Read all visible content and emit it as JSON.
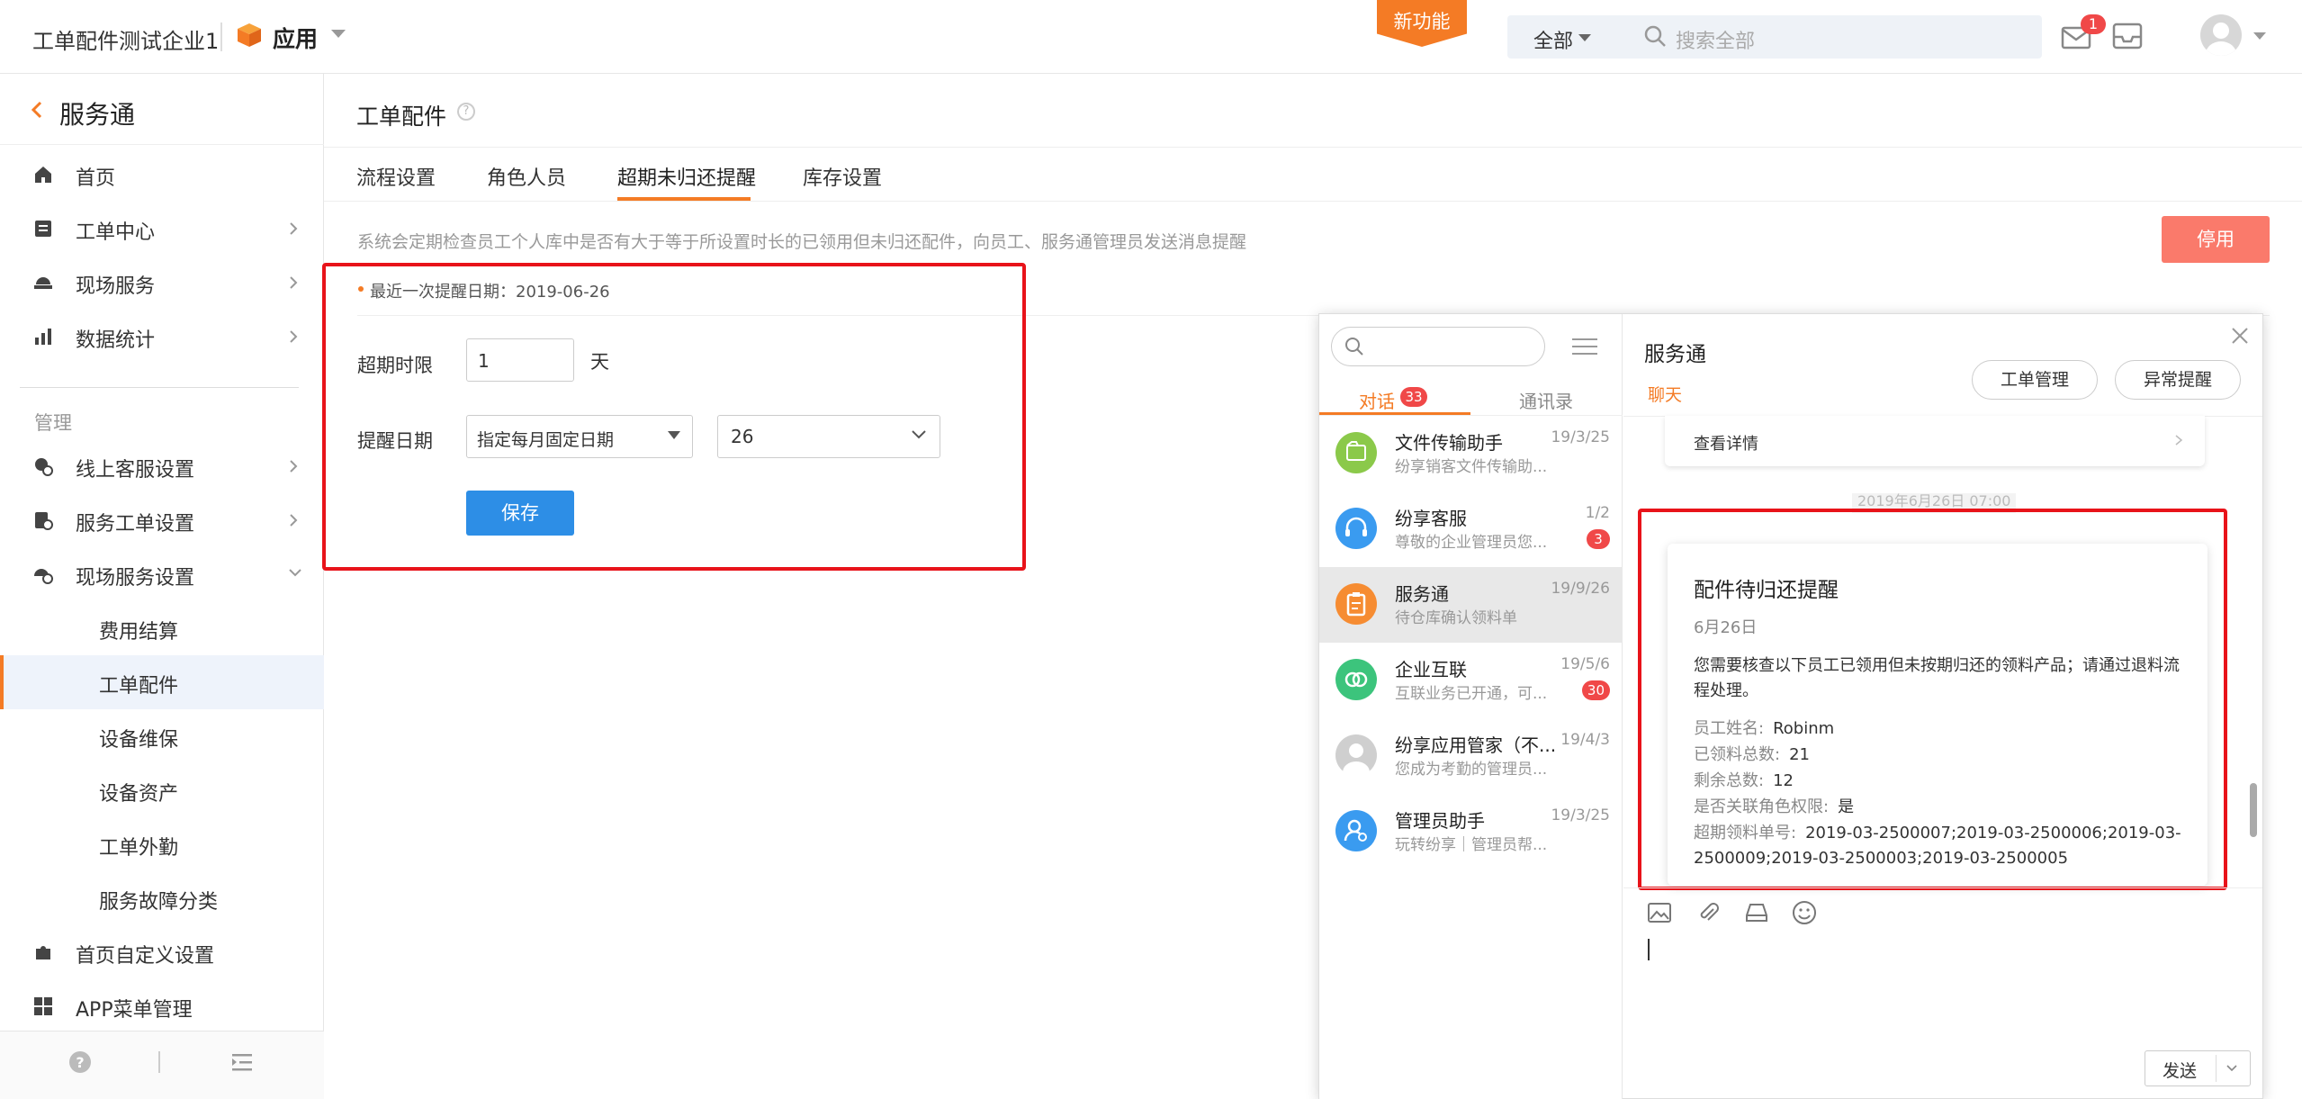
{
  "header": {
    "company": "工单配件测试企业1",
    "app_label": "应用",
    "new_feature": "新功能",
    "search_scope": "全部",
    "search_placeholder": "搜索全部",
    "mail_count": "1"
  },
  "sidebar": {
    "title": "服务通",
    "items": [
      {
        "label": "首页",
        "icon": "home-icon"
      },
      {
        "label": "工单中心",
        "icon": "workorder-icon"
      },
      {
        "label": "现场服务",
        "icon": "onsite-icon"
      },
      {
        "label": "数据统计",
        "icon": "chart-icon"
      }
    ],
    "group_label": "管理",
    "manage_items": [
      {
        "label": "线上客服设置",
        "icon": "cs-settings-icon"
      },
      {
        "label": "服务工单设置",
        "icon": "wo-settings-icon"
      },
      {
        "label": "现场服务设置",
        "icon": "onsite-settings-icon"
      }
    ],
    "sub_items": [
      "费用结算",
      "工单配件",
      "设备维保",
      "设备资产",
      "工单外勤",
      "服务故障分类"
    ],
    "bottom_items": [
      {
        "label": "首页自定义设置",
        "icon": "puzzle-icon"
      },
      {
        "label": "APP菜单管理",
        "icon": "apps-icon"
      }
    ]
  },
  "main": {
    "title": "工单配件",
    "tabs": [
      "流程设置",
      "角色人员",
      "超期未归还提醒",
      "库存设置"
    ],
    "description": "系统会定期检查员工个人库中是否有大于等于所设置时长的已领用但未归还配件，向员工、服务通管理员发送消息提醒",
    "stop_button": "停用",
    "last_remind": "最近一次提醒日期：2019-06-26",
    "overdue_label": "超期时限",
    "overdue_value": "1",
    "overdue_unit": "天",
    "remind_label": "提醒日期",
    "remind_mode": "指定每月固定日期",
    "remind_day": "26",
    "save_button": "保存"
  },
  "chat": {
    "tab_convo": "对话",
    "tab_convo_count": "33",
    "tab_contacts": "通讯录",
    "conversations": [
      {
        "name": "文件传输助手",
        "preview": "纷享销客文件传输助...",
        "time": "19/3/25",
        "badge": "",
        "color": "#8bc94a"
      },
      {
        "name": "纷享客服",
        "preview": "尊敬的企业管理员您...",
        "time": "1/2",
        "badge": "3",
        "color": "#3a9bf0"
      },
      {
        "name": "服务通",
        "preview": "待仓库确认领料单",
        "time": "19/9/26",
        "badge": "",
        "color": "#f68c32"
      },
      {
        "name": "企业互联",
        "preview": "互联业务已开通，可...",
        "time": "19/5/6",
        "badge": "30",
        "color": "#3cc47c"
      },
      {
        "name": "纷享应用管家（不...",
        "preview": "您成为考勤的管理员...",
        "time": "19/4/3",
        "badge": "",
        "color": "#cfcfcf"
      },
      {
        "name": "管理员助手",
        "preview": "玩转纷享｜管理员帮...",
        "time": "19/3/25",
        "badge": "",
        "color": "#3a9bf0"
      }
    ],
    "title": "服务通",
    "subtitle": "聊天",
    "btn_workorder": "工单管理",
    "btn_abnormal": "异常提醒",
    "detail_link": "查看详情",
    "timestamp": "2019年6月26日 07:00",
    "message": {
      "title": "配件待归还提醒",
      "date": "6月26日",
      "body": "您需要核查以下员工已领用但未按期归还的领料产品；请通过退料流程处理。",
      "fields": [
        {
          "k": "员工姓名:",
          "v": "Robinm"
        },
        {
          "k": "已领料总数:",
          "v": "21"
        },
        {
          "k": "剩余总数:",
          "v": "12"
        },
        {
          "k": "是否关联角色权限:",
          "v": "是"
        },
        {
          "k": "超期领料单号:",
          "v": "2019-03-2500007;2019-03-2500006;2019-03-2500009;2019-03-2500003;2019-03-2500005"
        }
      ]
    },
    "send_button": "发送"
  }
}
